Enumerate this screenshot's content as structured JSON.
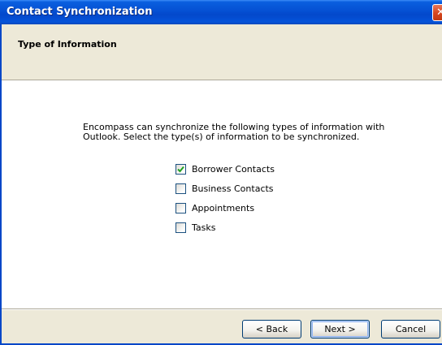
{
  "window": {
    "title": "Contact Synchronization",
    "close_icon": "close-icon"
  },
  "header": {
    "title": "Type of Information"
  },
  "content": {
    "intro_line1": "Encompass can synchronize the following types of information with",
    "intro_line2": "Outlook. Select the type(s) of information to be synchronized.",
    "options": [
      {
        "label": "Borrower Contacts",
        "checked": true
      },
      {
        "label": "Business Contacts",
        "checked": false
      },
      {
        "label": "Appointments",
        "checked": false
      },
      {
        "label": "Tasks",
        "checked": false
      }
    ]
  },
  "footer": {
    "back_label": "< Back",
    "next_label": "Next >",
    "cancel_label": "Cancel"
  },
  "colors": {
    "titlebar": "#0550d3",
    "band": "#ede9d8",
    "checkbox_border": "#1c5180",
    "checkmark": "#21a121"
  }
}
